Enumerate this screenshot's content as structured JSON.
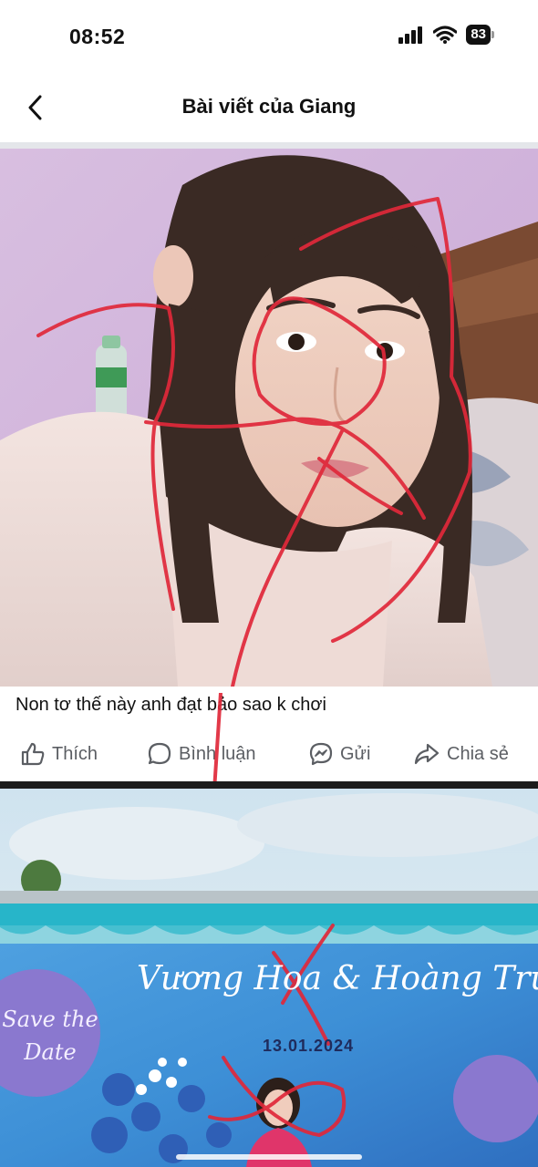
{
  "status_bar": {
    "time": "08:52",
    "battery": "83",
    "icons": [
      "signal-icon",
      "wifi-icon",
      "battery-icon"
    ]
  },
  "header": {
    "title": "Bài viết của Giang",
    "back_icon": "chevron-left-icon"
  },
  "post1": {
    "caption": "Non tơ thế này anh đạt bảo sao k chơi",
    "actions": [
      {
        "label": "Thích",
        "icon": "like-icon"
      },
      {
        "label": "Bình luận",
        "icon": "comment-icon"
      },
      {
        "label": "Gửi",
        "icon": "messenger-icon"
      },
      {
        "label": "Chia sẻ",
        "icon": "share-icon"
      }
    ]
  },
  "post2": {
    "banner_names": "Vương Hoa & Hoàng Trường",
    "banner_date": "13.01.2024",
    "badge_text": "Save the Date"
  },
  "colors": {
    "ink_red": "#e0283a",
    "action_gray": "#5b5e63",
    "banner_blue": "#3d8fd6",
    "purple_badge": "#8a78cf"
  }
}
